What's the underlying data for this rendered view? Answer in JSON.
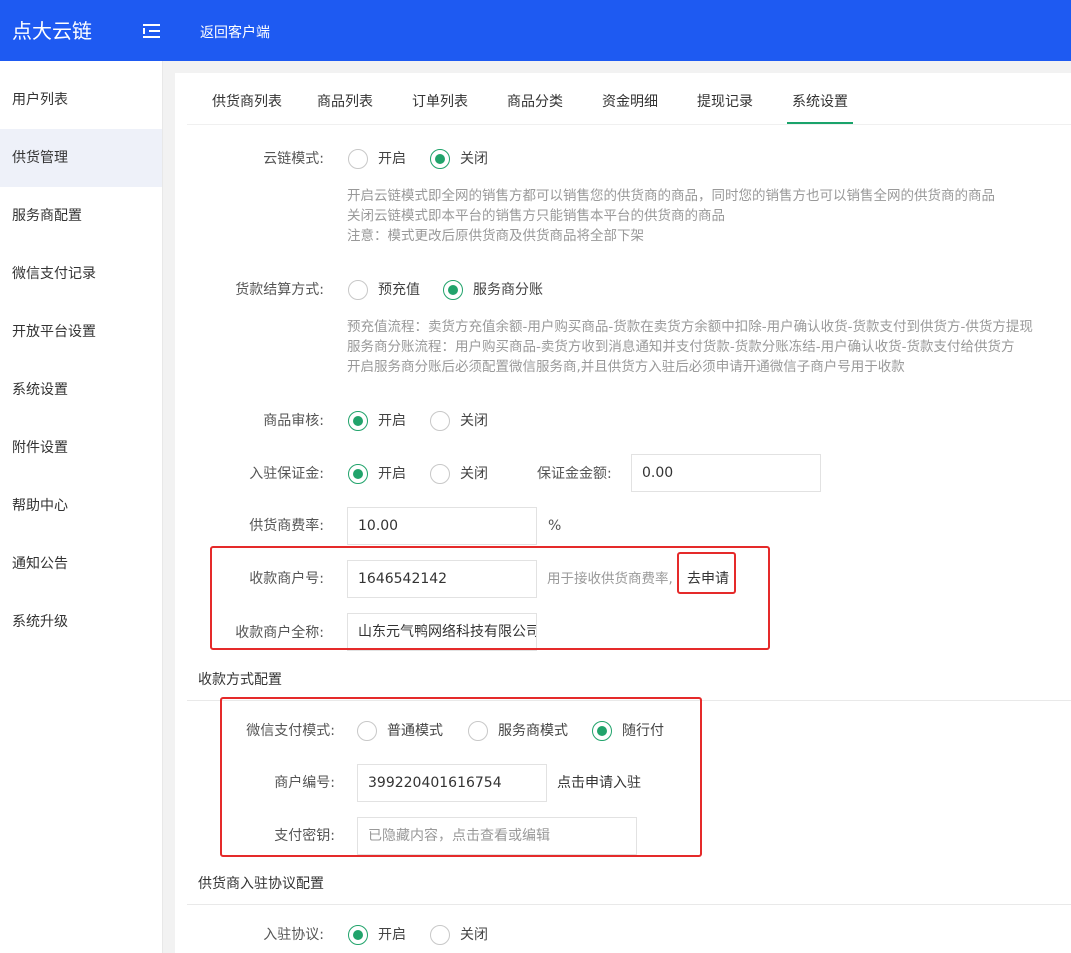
{
  "header": {
    "brand": "点大云链",
    "back_link": "返回客户端"
  },
  "sidebar": {
    "items": [
      {
        "label": "用户列表"
      },
      {
        "label": "供货管理",
        "active": true
      },
      {
        "label": "服务商配置"
      },
      {
        "label": "微信支付记录"
      },
      {
        "label": "开放平台设置"
      },
      {
        "label": "系统设置"
      },
      {
        "label": "附件设置"
      },
      {
        "label": "帮助中心"
      },
      {
        "label": "通知公告"
      },
      {
        "label": "系统升级"
      }
    ]
  },
  "tabs": [
    {
      "label": "供货商列表"
    },
    {
      "label": "商品列表"
    },
    {
      "label": "订单列表"
    },
    {
      "label": "商品分类"
    },
    {
      "label": "资金明细"
    },
    {
      "label": "提现记录"
    },
    {
      "label": "系统设置",
      "active": true
    }
  ],
  "form": {
    "cloud_mode": {
      "label": "云链模式:",
      "options": [
        "开启",
        "关闭"
      ],
      "selected": "关闭",
      "hints": [
        "开启云链模式即全网的销售方都可以销售您的供货商的商品，同时您的销售方也可以销售全网的供货商的商品",
        "关闭云链模式即本平台的销售方只能销售本平台的供货商的商品",
        "注意：模式更改后原供货商及供货商品将全部下架"
      ]
    },
    "settlement": {
      "label": "货款结算方式:",
      "options": [
        "预充值",
        "服务商分账"
      ],
      "selected": "服务商分账",
      "hints": [
        "预充值流程：卖货方充值余额-用户购买商品-货款在卖货方余额中扣除-用户确认收货-货款支付到供货方-供货方提现",
        "服务商分账流程：用户购买商品-卖货方收到消息通知并支付货款-货款分账冻结-用户确认收货-货款支付给供货方",
        "开启服务商分账后必须配置微信服务商,并且供货方入驻后必须申请开通微信子商户号用于收款"
      ]
    },
    "product_review": {
      "label": "商品审核:",
      "options": [
        "开启",
        "关闭"
      ],
      "selected": "开启"
    },
    "deposit": {
      "label": "入驻保证金:",
      "options": [
        "开启",
        "关闭"
      ],
      "selected": "开启",
      "amount_label": "保证金金额:",
      "amount": "0.00"
    },
    "fee_rate": {
      "label": "供货商费率:",
      "value": "10.00",
      "unit": "%"
    },
    "merchant_no": {
      "label": "收款商户号:",
      "value": "1646542142",
      "hint": "用于接收供货商费率,",
      "apply": "去申请"
    },
    "merchant_name": {
      "label": "收款商户全称:",
      "value": "山东元气鸭网络科技有限公司"
    }
  },
  "payment": {
    "title": "收款方式配置",
    "mode": {
      "label": "微信支付模式:",
      "options": [
        "普通模式",
        "服务商模式",
        "随行付"
      ],
      "selected": "随行付"
    },
    "merchant_id": {
      "label": "商户编号:",
      "value": "399220401616754",
      "hint": "点击申请入驻"
    },
    "secret": {
      "label": "支付密钥:",
      "placeholder": "已隐藏内容，点击查看或编辑"
    }
  },
  "agreement": {
    "title": "供货商入驻协议配置",
    "enable": {
      "label": "入驻协议:",
      "options": [
        "开启",
        "关闭"
      ],
      "selected": "开启"
    }
  },
  "colors": {
    "header": "#1e5af2",
    "accent": "#21a36b",
    "highlight": "#e52a2a"
  }
}
